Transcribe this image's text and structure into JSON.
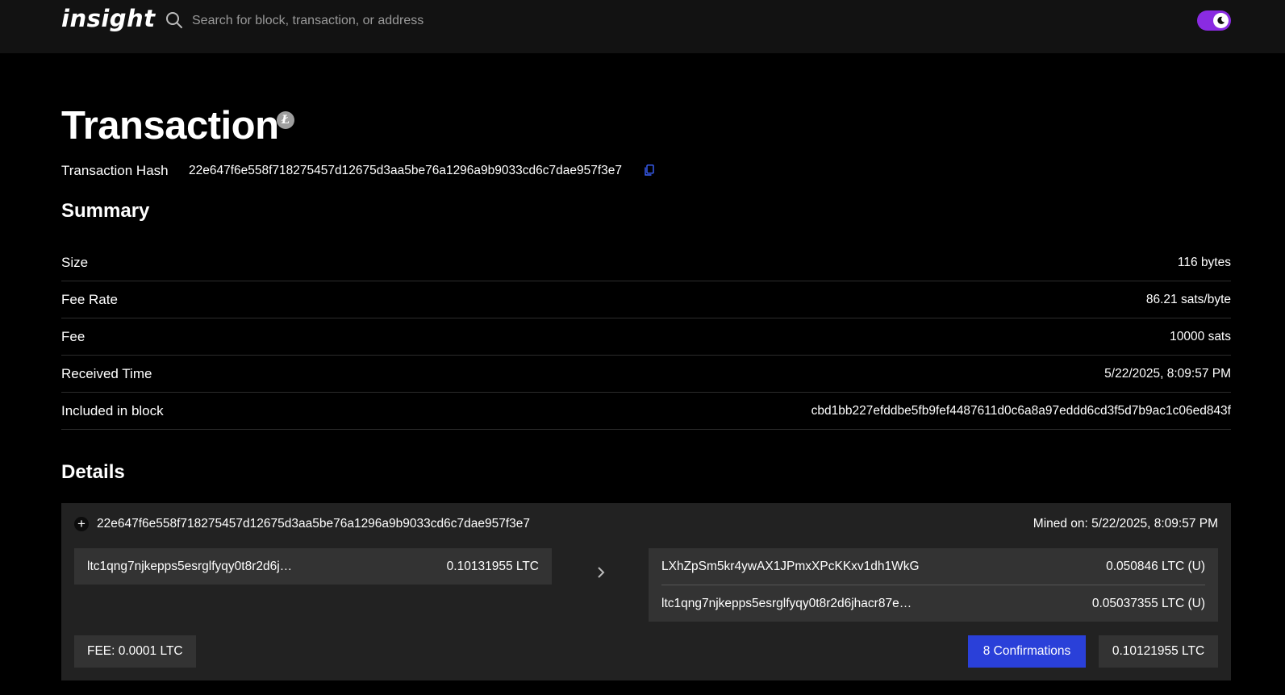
{
  "header": {
    "logo": "insight",
    "search_placeholder": "Search for block, transaction, or address",
    "theme_toggle_accent": "#8a2be2"
  },
  "page": {
    "title": "Transaction",
    "coin_icon": "litecoin-icon",
    "hash_label": "Transaction Hash",
    "hash_value": "22e647f6e558f718275457d12675d3aa5be76a1296a9b9033cd6c7dae957f3e7"
  },
  "summary": {
    "title": "Summary",
    "rows": [
      {
        "label": "Size",
        "value": "116 bytes"
      },
      {
        "label": "Fee Rate",
        "value": "86.21 sats/byte"
      },
      {
        "label": "Fee",
        "value": "10000 sats"
      },
      {
        "label": "Received Time",
        "value": "5/22/2025, 8:09:57 PM"
      },
      {
        "label": "Included in block",
        "value": "cbd1bb227efddbe5fb9fef4487611d0c6a8a97eddd6cd3f5d7b9ac1c06ed843f"
      }
    ]
  },
  "details": {
    "title": "Details",
    "tx_hash": "22e647f6e558f718275457d12675d3aa5be76a1296a9b9033cd6c7dae957f3e7",
    "mined_on": "Mined on: 5/22/2025, 8:09:57 PM",
    "inputs": [
      {
        "address": "ltc1qng7njkepps5esrglfyqy0t8r2d6j…",
        "amount": "0.10131955 LTC"
      }
    ],
    "outputs": [
      {
        "address": "LXhZpSm5kr4ywAX1JPmxXPcKKxv1dh1WkG",
        "amount": "0.050846 LTC (U)"
      },
      {
        "address": "ltc1qng7njkepps5esrglfyqy0t8r2d6jhacr87e…",
        "amount": "0.05037355 LTC (U)"
      }
    ],
    "fee": "FEE: 0.0001 LTC",
    "confirmations": "8 Confirmations",
    "confirmations_color": "#2a40d9",
    "total": "0.10121955 LTC"
  }
}
